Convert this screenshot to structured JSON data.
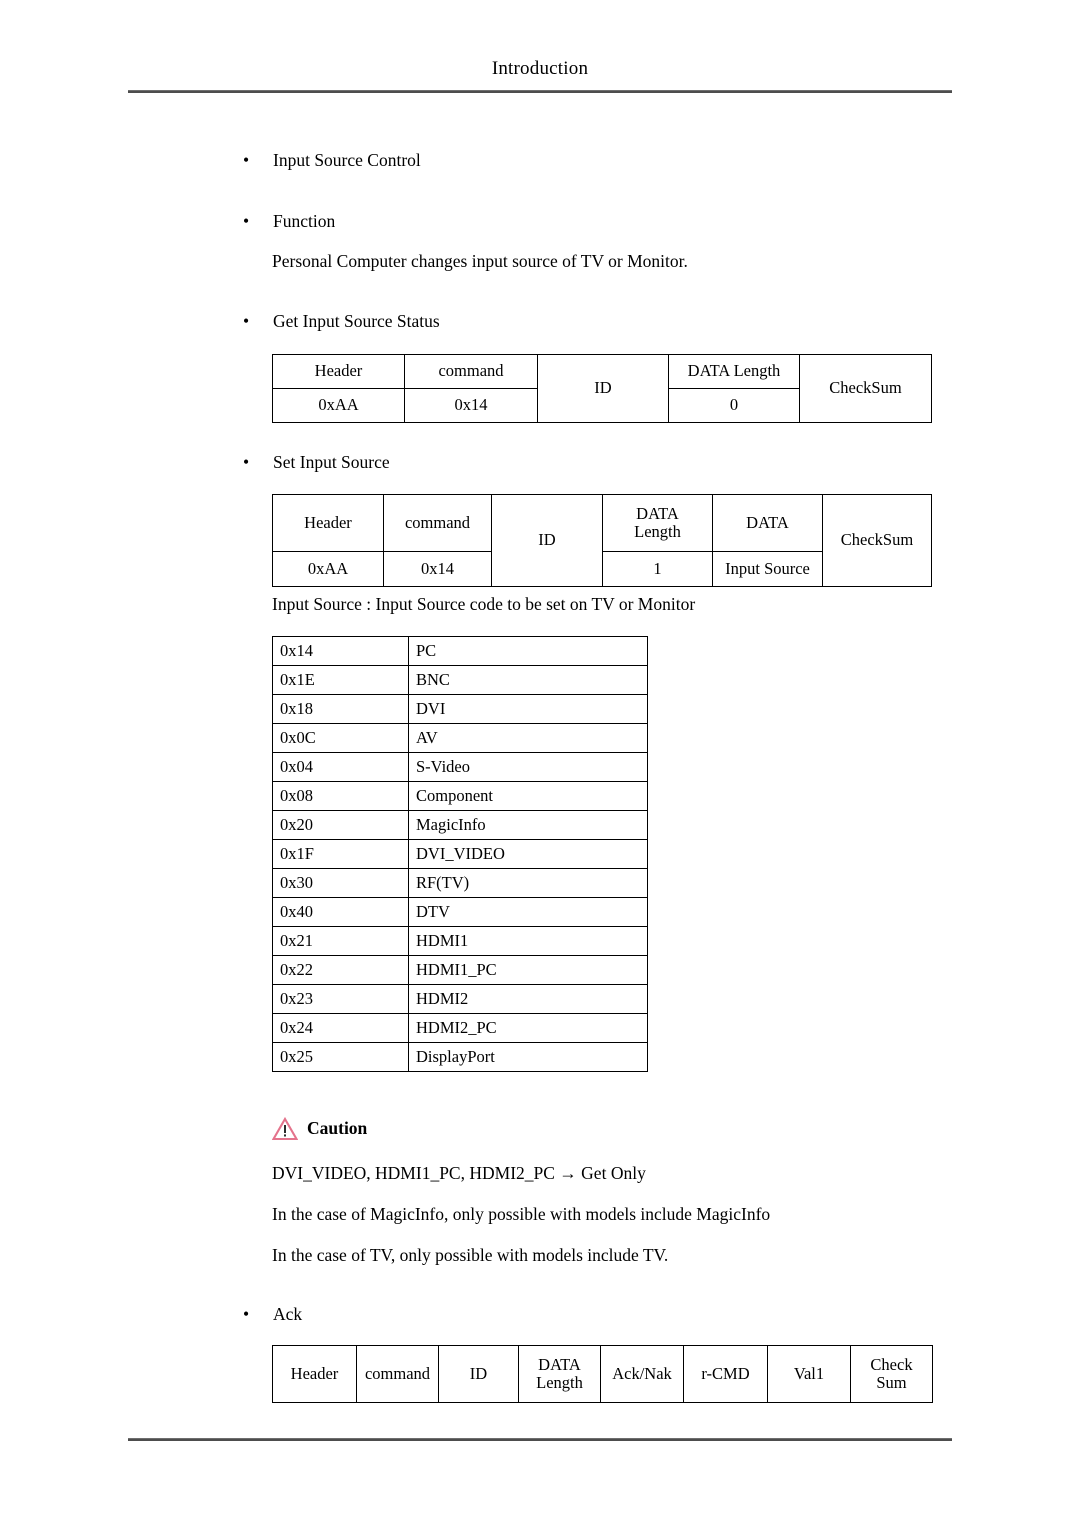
{
  "document": {
    "header_title": "Introduction"
  },
  "sections": {
    "input_source_control": "Input Source Control",
    "function_label": "Function",
    "function_text": "Personal Computer changes input source of TV or Monitor.",
    "get_input_source_status": "Get Input Source Status",
    "set_input_source": "Set Input Source",
    "input_source_note": "Input Source : Input Source code to be set on TV or Monitor",
    "ack_label": "Ack"
  },
  "get_status_table": {
    "columns": [
      "Header",
      "command",
      "ID",
      "DATA Length",
      "CheckSum"
    ],
    "values": [
      "0xAA",
      "0x14",
      "",
      "0",
      ""
    ]
  },
  "set_source_table": {
    "columns": [
      "Header",
      "command",
      "ID",
      "DATA\nLength",
      "DATA",
      "CheckSum"
    ],
    "col_header": "Header",
    "col_command": "command",
    "col_id": "ID",
    "col_data_length_line1": "DATA",
    "col_data_length_line2": "Length",
    "col_data": "DATA",
    "col_checksum": "CheckSum",
    "val_header": "0xAA",
    "val_command": "0x14",
    "val_data_length": "1",
    "val_data": "Input Source"
  },
  "get_status_labels": {
    "col_header": "Header",
    "col_command": "command",
    "col_id": "ID",
    "col_data_length": "DATA Length",
    "col_checksum": "CheckSum",
    "val_header": "0xAA",
    "val_command": "0x14",
    "val_data_length": "0"
  },
  "input_source_codes": {
    "rows": [
      {
        "code": "0x14",
        "name": "PC"
      },
      {
        "code": "0x1E",
        "name": "BNC"
      },
      {
        "code": "0x18",
        "name": "DVI"
      },
      {
        "code": "0x0C",
        "name": "AV"
      },
      {
        "code": "0x04",
        "name": "S-Video"
      },
      {
        "code": "0x08",
        "name": "Component"
      },
      {
        "code": "0x20",
        "name": "MagicInfo"
      },
      {
        "code": "0x1F",
        "name": "DVI_VIDEO"
      },
      {
        "code": "0x30",
        "name": "RF(TV)"
      },
      {
        "code": "0x40",
        "name": "DTV"
      },
      {
        "code": "0x21",
        "name": "HDMI1"
      },
      {
        "code": "0x22",
        "name": "HDMI1_PC"
      },
      {
        "code": "0x23",
        "name": "HDMI2"
      },
      {
        "code": "0x24",
        "name": "HDMI2_PC"
      },
      {
        "code": "0x25",
        "name": "DisplayPort"
      }
    ]
  },
  "caution": {
    "title": "Caution",
    "icon": "warning-triangle-icon",
    "icon_color": "#e4738c",
    "lines": [
      "DVI_VIDEO, HDMI1_PC, HDMI2_PC → Get Only",
      "In the case of MagicInfo, only possible with models include MagicInfo",
      "In the case of TV, only possible with models include TV."
    ]
  },
  "ack_table": {
    "col_header": "Header",
    "col_command": "command",
    "col_id": "ID",
    "col_data_length_line1": "DATA",
    "col_data_length_line2": "Length",
    "col_ack_nak": "Ack/Nak",
    "col_rcmd": "r-CMD",
    "col_val1": "Val1",
    "col_checksum_line1": "Check",
    "col_checksum_line2": "Sum"
  }
}
